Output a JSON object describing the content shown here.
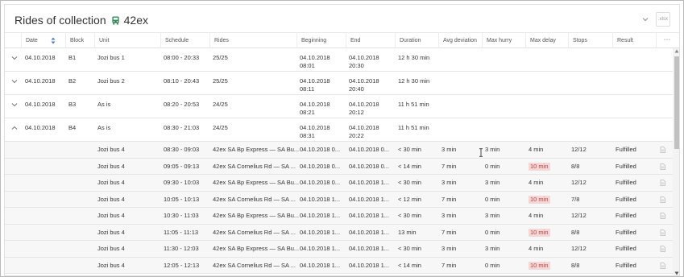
{
  "header": {
    "title_prefix": "Rides of collection",
    "collection_name": "42ex",
    "export_label": ".xlsx",
    "bus_icon": "bus-icon",
    "accent_color": "#2e8b57"
  },
  "columns": {
    "date": "Date",
    "block": "Block",
    "unit": "Unit",
    "schedule": "Schedule",
    "rides": "Rides",
    "beginning": "Beginning",
    "end": "End",
    "duration": "Duration",
    "avg_deviation": "Avg deviation",
    "max_hurry": "Max hurry",
    "max_delay": "Max delay",
    "stops": "Stops",
    "result": "Result",
    "more": "⋯"
  },
  "groups": [
    {
      "expanded": false,
      "date": "04.10.2018",
      "block": "B1",
      "unit": "Jozi bus 1",
      "schedule": "08:00 - 20:33",
      "rides": "25/25",
      "begin_date": "04.10.2018",
      "begin_time": "08:01",
      "end_date": "04.10.2018",
      "end_time": "20:30",
      "duration": "12 h 30 min"
    },
    {
      "expanded": false,
      "date": "04.10.2018",
      "block": "B2",
      "unit": "Jozi bus 2",
      "schedule": "08:10 - 20:43",
      "rides": "25/25",
      "begin_date": "04.10.2018",
      "begin_time": "08:11",
      "end_date": "04.10.2018",
      "end_time": "20:40",
      "duration": "12 h 30 min"
    },
    {
      "expanded": false,
      "date": "04.10.2018",
      "block": "B3",
      "unit": "As is",
      "schedule": "08:20 - 20:53",
      "rides": "24/25",
      "begin_date": "04.10.2018",
      "begin_time": "08:21",
      "end_date": "04.10.2018",
      "end_time": "20:12",
      "duration": "11 h 51 min"
    },
    {
      "expanded": true,
      "date": "04.10.2018",
      "block": "B4",
      "unit": "As is",
      "schedule": "08:30 - 21:03",
      "rides": "24/25",
      "begin_date": "04.10.2018",
      "begin_time": "08:31",
      "end_date": "04.10.2018",
      "end_time": "20:22",
      "duration": "11 h 51 min"
    }
  ],
  "rides": [
    {
      "unit": "Jozi bus 4",
      "schedule": "08:30 - 09:03",
      "ride": "42ex SA Bp Express — SA Bu...",
      "beginning": "04.10.2018 0...",
      "end": "04.10.2018 0...",
      "duration": "< 30 min",
      "avg_dev": "3 min",
      "max_hurry": "3 min",
      "max_delay": "4 min",
      "delay_flag": false,
      "stops": "12/12",
      "result": "Fulfilled"
    },
    {
      "unit": "Jozi bus 4",
      "schedule": "09:05 - 09:13",
      "ride": "42ex SA Cornelius Rd — SA ...",
      "beginning": "04.10.2018 0...",
      "end": "04.10.2018 0...",
      "duration": "< 14 min",
      "avg_dev": "7 min",
      "max_hurry": "0 min",
      "max_delay": "10 min",
      "delay_flag": true,
      "stops": "8/8",
      "result": "Fulfilled"
    },
    {
      "unit": "Jozi bus 4",
      "schedule": "09:30 - 10:03",
      "ride": "42ex SA Bp Express — SA Bu...",
      "beginning": "04.10.2018 0...",
      "end": "04.10.2018 1...",
      "duration": "< 30 min",
      "avg_dev": "3 min",
      "max_hurry": "3 min",
      "max_delay": "4 min",
      "delay_flag": false,
      "stops": "12/12",
      "result": "Fulfilled"
    },
    {
      "unit": "Jozi bus 4",
      "schedule": "10:05 - 10:13",
      "ride": "42ex SA Cornelius Rd — SA ...",
      "beginning": "04.10.2018 1...",
      "end": "04.10.2018 1...",
      "duration": "< 12 min",
      "avg_dev": "7 min",
      "max_hurry": "0 min",
      "max_delay": "10 min",
      "delay_flag": true,
      "stops": "7/8",
      "result": "Fulfilled"
    },
    {
      "unit": "Jozi bus 4",
      "schedule": "10:30 - 11:03",
      "ride": "42ex SA Bp Express — SA Bu...",
      "beginning": "04.10.2018 1...",
      "end": "04.10.2018 1...",
      "duration": "< 30 min",
      "avg_dev": "3 min",
      "max_hurry": "3 min",
      "max_delay": "4 min",
      "delay_flag": false,
      "stops": "12/12",
      "result": "Fulfilled"
    },
    {
      "unit": "Jozi bus 4",
      "schedule": "11:05 - 11:13",
      "ride": "42ex SA Cornelius Rd — SA ...",
      "beginning": "04.10.2018 1...",
      "end": "04.10.2018 1...",
      "duration": "13 min",
      "avg_dev": "7 min",
      "max_hurry": "0 min",
      "max_delay": "10 min",
      "delay_flag": true,
      "stops": "8/8",
      "result": "Fulfilled"
    },
    {
      "unit": "Jozi bus 4",
      "schedule": "11:30 - 12:03",
      "ride": "42ex SA Bp Express — SA Bu...",
      "beginning": "04.10.2018 1...",
      "end": "04.10.2018 1...",
      "duration": "< 30 min",
      "avg_dev": "3 min",
      "max_hurry": "3 min",
      "max_delay": "4 min",
      "delay_flag": false,
      "stops": "12/12",
      "result": "Fulfilled"
    },
    {
      "unit": "Jozi bus 4",
      "schedule": "12:05 - 12:13",
      "ride": "42ex SA Cornelius Rd — SA ...",
      "beginning": "04.10.2018 1...",
      "end": "04.10.2018 1...",
      "duration": "< 14 min",
      "avg_dev": "7 min",
      "max_hurry": "0 min",
      "max_delay": "10 min",
      "delay_flag": true,
      "stops": "8/8",
      "result": "Fulfilled"
    }
  ]
}
